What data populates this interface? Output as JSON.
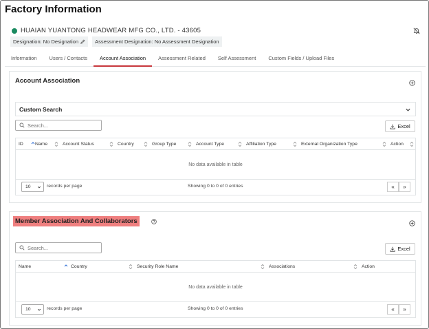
{
  "page_title": "Factory Information",
  "factory": {
    "name": "HUAIAN YUANTONG HEADWEAR MFG CO., LTD. - 43605",
    "status_color": "#1a8a60",
    "designation": "Designation: No Designation",
    "assessment_designation": "Assessment Designation: No Assessment Designation"
  },
  "tabs": [
    {
      "label": "Information"
    },
    {
      "label": "Users / Contacts"
    },
    {
      "label": "Account Association"
    },
    {
      "label": "Assessment Related"
    },
    {
      "label": "Self Assessment"
    },
    {
      "label": "Custom Fields / Upload Files"
    }
  ],
  "active_tab": "Account Association",
  "accent_color": "#c8363c",
  "account_panel": {
    "title": "Account Association",
    "custom_search_label": "Custom Search",
    "search_placeholder": "Search...",
    "excel_label": "Excel",
    "columns": [
      "ID",
      "Name",
      "Account Status",
      "Country",
      "Group Type",
      "Account Type",
      "Affiliation Type",
      "External Organization Type",
      "Action"
    ],
    "empty_text": "No data available in table",
    "per_page_value": "10",
    "per_page_label": "records per page",
    "showing_text": "Showing 0 to 0 of 0 entries",
    "prev_label": "«",
    "next_label": "»"
  },
  "member_panel": {
    "title": "Member Association And Collaborators",
    "search_placeholder": "Search...",
    "excel_label": "Excel",
    "columns": [
      "Name",
      "Country",
      "Security Role Name",
      "Associations",
      "Action"
    ],
    "empty_text": "No data available in table",
    "per_page_value": "10",
    "per_page_label": "records per page",
    "showing_text": "Showing 0 to 0 of 0 entries",
    "prev_label": "«",
    "next_label": "»"
  }
}
